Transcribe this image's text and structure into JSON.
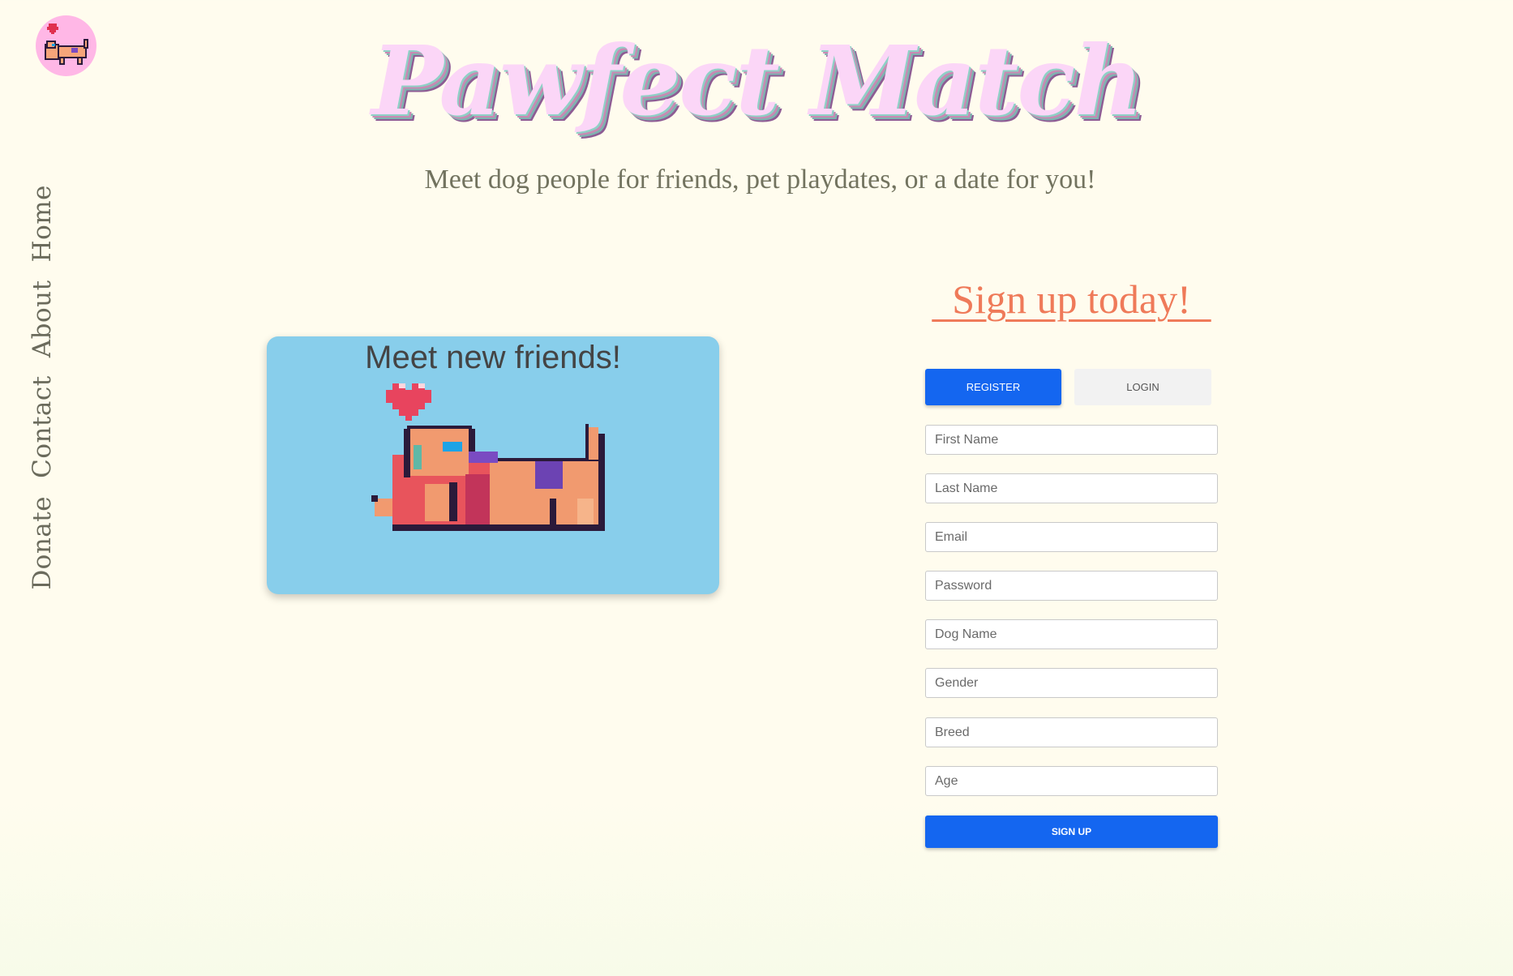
{
  "brand": {
    "title": "Pawfect Match",
    "tagline": "Meet dog people for friends, pet playdates, or a date for you!",
    "logo_icon": "dog-couple-logo-icon",
    "title_color": "#fbd6f7"
  },
  "nav": {
    "items": [
      {
        "label": "Home"
      },
      {
        "label": "About"
      },
      {
        "label": "Contact"
      },
      {
        "label": "Donate"
      }
    ]
  },
  "card": {
    "title": "Meet new friends!",
    "image_icon": "pixel-dogs-with-heart-icon",
    "background": "#88ceeb"
  },
  "signup": {
    "heading": "  Sign up today!  ",
    "tabs": {
      "register": "Register",
      "login": "Login",
      "active": "register"
    },
    "fields": [
      {
        "placeholder": "First Name",
        "value": ""
      },
      {
        "placeholder": "Last Name",
        "value": ""
      },
      {
        "placeholder": "Email",
        "value": ""
      },
      {
        "placeholder": "Password",
        "value": ""
      },
      {
        "placeholder": "Dog Name",
        "value": ""
      },
      {
        "placeholder": "Gender",
        "value": ""
      },
      {
        "placeholder": "Breed",
        "value": ""
      },
      {
        "placeholder": "Age",
        "value": ""
      }
    ],
    "submit_label": "Sign Up",
    "accent_color": "#1466f0",
    "heading_color": "#ef7a59"
  }
}
